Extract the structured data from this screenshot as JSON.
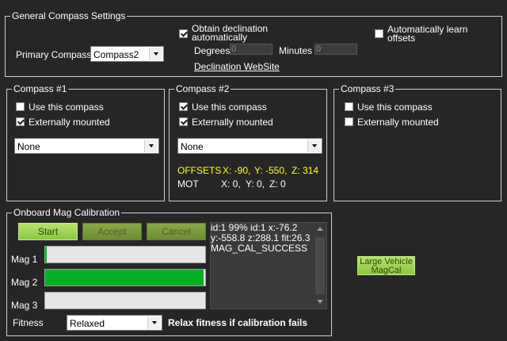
{
  "general": {
    "legend": "General Compass Settings",
    "primary_label": "Primary Compass:",
    "primary_value": "Compass2",
    "obtain_declination_line1": "Obtain declination",
    "obtain_declination_line2": "automatically",
    "obtain_declination_checked": true,
    "auto_learn_line1": "Automatically learn",
    "auto_learn_line2": "offsets",
    "auto_learn_checked": false,
    "degrees_label": "Degrees",
    "degrees_value": "0",
    "minutes_label": "Minutes",
    "minutes_value": "0",
    "declination_link": "Declination WebSite"
  },
  "compass1": {
    "legend": "Compass #1",
    "use_label": "Use this compass",
    "use_checked": false,
    "ext_label": "Externally mounted",
    "ext_checked": true,
    "orientation": "None"
  },
  "compass2": {
    "legend": "Compass #2",
    "use_label": "Use this compass",
    "use_checked": true,
    "ext_label": "Externally mounted",
    "ext_checked": true,
    "orientation": "None",
    "offsets_label": "OFFSETS",
    "offsets_x": "X: -90,",
    "offsets_y": "Y: -550,",
    "offsets_z": "Z: 314",
    "mot_label": "MOT",
    "mot_x": "X: 0,",
    "mot_y": "Y: 0,",
    "mot_z": "Z: 0"
  },
  "compass3": {
    "legend": "Compass #3",
    "use_label": "Use this compass",
    "use_checked": false,
    "ext_label": "Externally mounted",
    "ext_checked": false
  },
  "onboard": {
    "legend": "Onboard Mag Calibration",
    "start_label": "Start",
    "accept_label": "Accept",
    "cancel_label": "Cancel",
    "mag1_label": "Mag 1",
    "mag1_progress": 1,
    "mag2_label": "Mag 2",
    "mag2_progress": 99,
    "mag3_label": "Mag 3",
    "mag3_progress": 0,
    "fitness_label": "Fitness",
    "fitness_value": "Relaxed",
    "relax_note": "Relax fitness if calibration fails",
    "log_line1": "id:1 99% id:1 x:-76.2 y:-558.8 z:288.1 fit:26.3",
    "log_line2": "MAG_CAL_SUCCESS"
  },
  "large_vehicle": {
    "line1": "Large Vehicle",
    "line2": "MagCal"
  }
}
